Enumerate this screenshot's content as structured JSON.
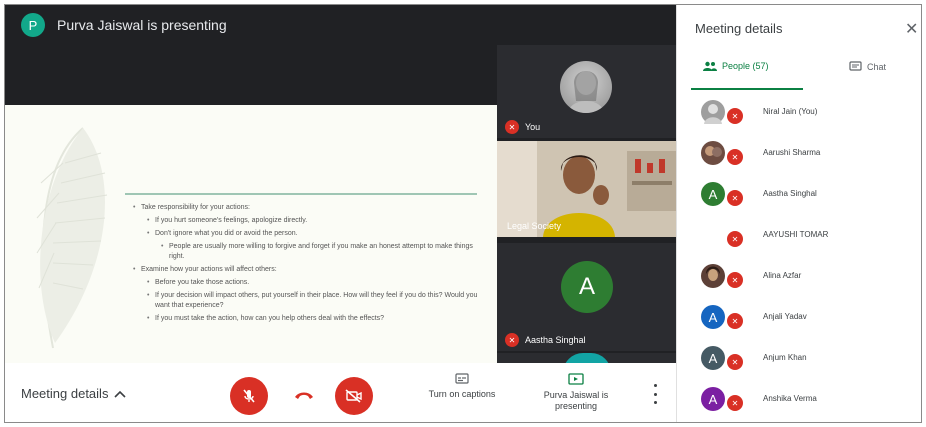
{
  "presenter": {
    "initial": "P",
    "title": "Purva Jaiswal is presenting"
  },
  "slide": {
    "bullets": [
      {
        "level": 1,
        "text": "Take responsibility  for your actions:"
      },
      {
        "level": 2,
        "text": "If you hurt someone's feelings, apologize  directly."
      },
      {
        "level": 2,
        "text": "Don't ignore what you did or avoid the person."
      },
      {
        "level": 3,
        "text": "People are usually more willing to forgive and forget if you make an honest attempt to make things right."
      },
      {
        "level": 1,
        "text": "Examine how your actions will affect others:"
      },
      {
        "level": 2,
        "text": "Before you take those actions."
      },
      {
        "level": 2,
        "text": "If your decision will impact others, put yourself in their place. How will they feel if you do this? Would you want that experience?"
      },
      {
        "level": 2,
        "text": "If you must take the action, how can you help others deal with the effects?"
      }
    ]
  },
  "tiles": [
    {
      "name": "You"
    },
    {
      "name": "Legal Society"
    },
    {
      "name": "Aastha Singhal",
      "initial": "A"
    }
  ],
  "bottom_bar": {
    "meeting_details": "Meeting details",
    "captions_label": "Turn on captions",
    "presenting_label": "Purva Jaiswal is presenting"
  },
  "panel": {
    "title": "Meeting details",
    "people_tab": "People (57)",
    "chat_tab": "Chat",
    "people": [
      {
        "name": "Niral Jain (You)",
        "initial": "",
        "color": "#9e9e9e"
      },
      {
        "name": "Aarushi Sharma",
        "initial": "",
        "color": "#6d4c41"
      },
      {
        "name": "Aastha Singhal",
        "initial": "A",
        "color": "#2e7d32"
      },
      {
        "name": "AAYUSHI TOMAR",
        "initial": "",
        "color": "#ffffff"
      },
      {
        "name": "Alina Azfar",
        "initial": "",
        "color": "#5d4037"
      },
      {
        "name": "Anjali Yadav",
        "initial": "A",
        "color": "#1565c0"
      },
      {
        "name": "Anjum Khan",
        "initial": "A",
        "color": "#455a64"
      },
      {
        "name": "Anshika Verma",
        "initial": "A",
        "color": "#7b1fa2"
      }
    ]
  },
  "colors": {
    "accent": "#0b8043",
    "danger": "#d93025",
    "dark": "#202124"
  },
  "icons": {
    "mic_off": "mic-off-icon",
    "end_call": "phone-hangup-icon",
    "camera_off": "camera-off-icon",
    "captions": "captions-icon",
    "present": "present-screen-icon",
    "more": "more-vert-icon",
    "people": "people-icon",
    "chat": "chat-icon",
    "close": "close-icon",
    "chevron": "chevron-up-icon"
  }
}
